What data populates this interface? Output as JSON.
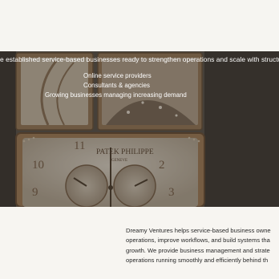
{
  "hero": {
    "tagline": "e established service-based businesses ready to strengthen operations and scale with structure.",
    "audience": [
      "Online service providers",
      "Consultants & agencies",
      "Growing businesses managing increasing demand"
    ],
    "watch_brand": "PATEK PHILIPPE",
    "watch_location": "GENEVE"
  },
  "about": {
    "lines": [
      "Dreamy Ventures helps service-based business owne",
      "operations, improve workflows, and build systems tha",
      "growth. We provide business management and strate",
      "operations running smoothly and efficiently behind th"
    ]
  },
  "colors": {
    "page_bg": "#f7f5f1",
    "hero_overlay": "#2a2622",
    "watch_gold": "#b08a62",
    "watch_dial": "#cfc4b4"
  }
}
